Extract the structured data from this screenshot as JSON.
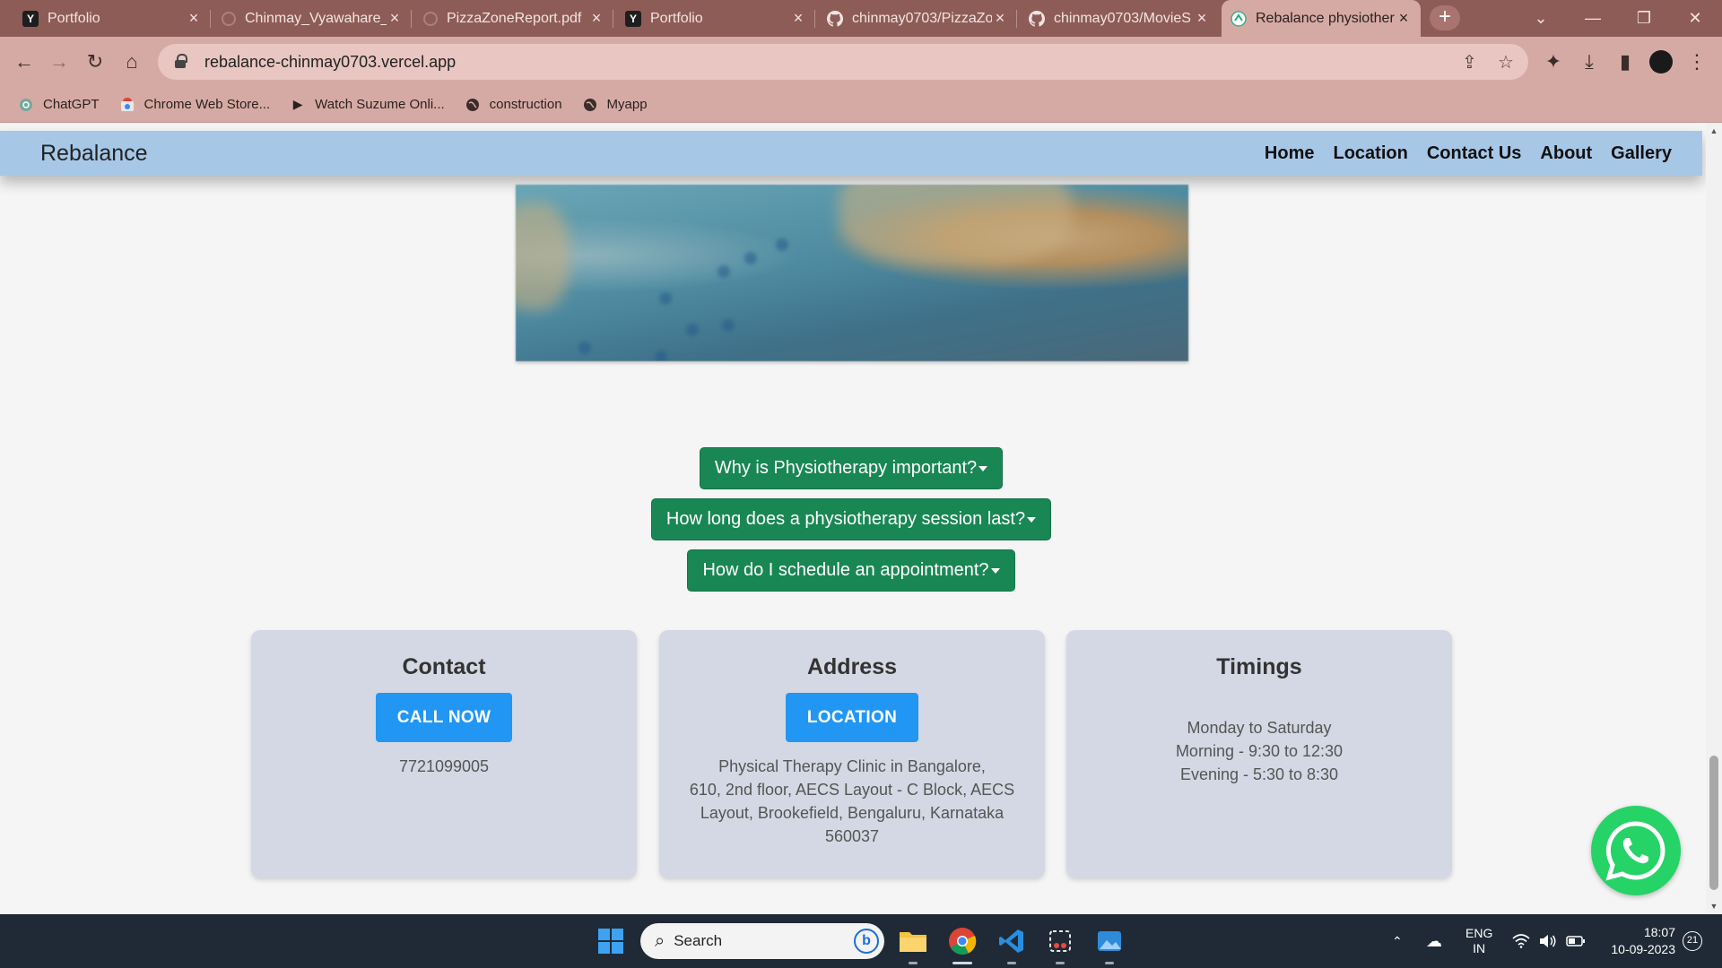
{
  "browser": {
    "tabs": [
      {
        "title": "Portfolio",
        "favicon": "y-icon",
        "active": false
      },
      {
        "title": "Chinmay_Vyawahare_",
        "favicon": "globe-icon",
        "active": false
      },
      {
        "title": "PizzaZoneReport.pdf",
        "favicon": "globe-icon",
        "active": false
      },
      {
        "title": "Portfolio",
        "favicon": "y-icon",
        "active": false
      },
      {
        "title": "chinmay0703/PizzaZo",
        "favicon": "github-icon",
        "active": false
      },
      {
        "title": "chinmay0703/MovieS",
        "favicon": "github-icon",
        "active": false
      },
      {
        "title": "Rebalance physiother",
        "favicon": "rebalance-icon",
        "active": true
      }
    ],
    "url": "rebalance-chinmay0703.vercel.app",
    "bookmarks": [
      {
        "label": "ChatGPT",
        "icon": "chatgpt-icon"
      },
      {
        "label": "Chrome Web Store...",
        "icon": "chrome-store-icon"
      },
      {
        "label": "Watch Suzume Onli...",
        "icon": "play-icon"
      },
      {
        "label": "construction",
        "icon": "globe-icon"
      },
      {
        "label": "Myapp",
        "icon": "globe-icon"
      }
    ]
  },
  "site": {
    "brand": "Rebalance",
    "nav": [
      "Home",
      "Location",
      "Contact Us",
      "About",
      "Gallery"
    ],
    "faq": [
      "Why is Physiotherapy important?",
      "How long does a physiotherapy session last?",
      "How do I schedule an appointment?"
    ],
    "cards": {
      "contact": {
        "title": "Contact",
        "button": "CALL NOW",
        "lines": [
          "7721099005"
        ]
      },
      "address": {
        "title": "Address",
        "button": "LOCATION",
        "lines": [
          "Physical Therapy Clinic in Bangalore,",
          "610, 2nd floor, AECS Layout - C Block, AECS",
          "Layout, Brookefield, Bengaluru, Karnataka",
          "560037"
        ]
      },
      "timings": {
        "title": "Timings",
        "lines": [
          "Monday to Saturday",
          "Morning - 9:30 to 12:30",
          "Evening - 5:30 to 8:30"
        ]
      }
    },
    "colors": {
      "navbar": "#a7c7e7",
      "faq_button": "#198754",
      "cta_button": "#2196f3",
      "card": "#d4d8e4",
      "whatsapp": "#25d366"
    }
  },
  "taskbar": {
    "search_placeholder": "Search",
    "lang": "ENG",
    "region": "IN",
    "time": "18:07",
    "date": "10-09-2023",
    "notification_count": "21"
  }
}
